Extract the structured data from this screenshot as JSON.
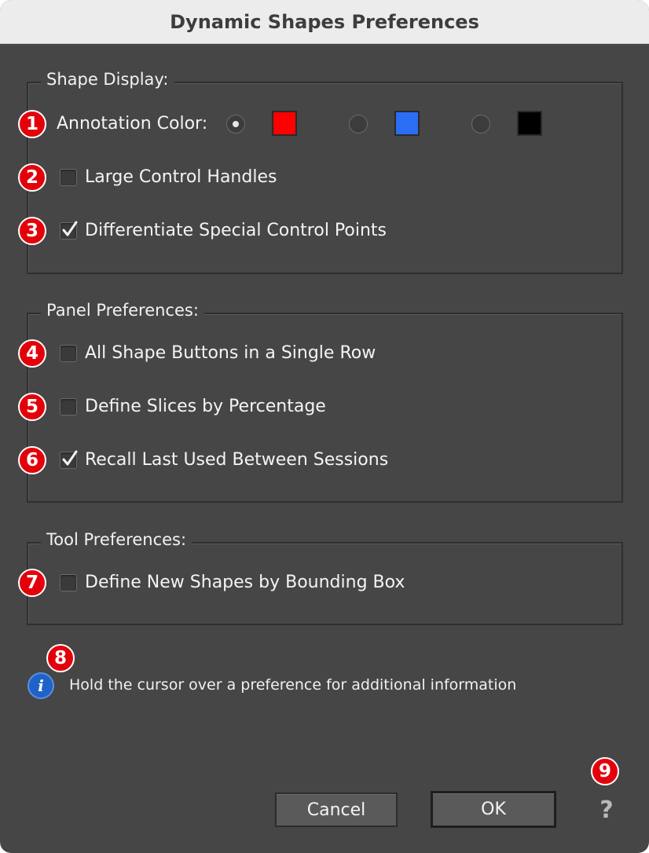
{
  "window": {
    "title": "Dynamic Shapes Preferences"
  },
  "shape_display": {
    "title": "Shape Display:",
    "annotation_color": {
      "label": "Annotation Color:",
      "options": [
        {
          "color": "#ff0000",
          "selected": true
        },
        {
          "color": "#2a6ef5",
          "selected": false
        },
        {
          "color": "#000000",
          "selected": false
        }
      ]
    },
    "large_control_handles": {
      "label": "Large Control Handles",
      "checked": false
    },
    "differentiate_special_points": {
      "label": "Differentiate Special Control Points",
      "checked": true
    }
  },
  "panel_preferences": {
    "title": "Panel Preferences:",
    "single_row": {
      "label": "All Shape Buttons in a Single Row",
      "checked": false
    },
    "slices_by_percentage": {
      "label": "Define Slices by Percentage",
      "checked": false
    },
    "recall_last_used": {
      "label": "Recall Last Used Between Sessions",
      "checked": true
    }
  },
  "tool_preferences": {
    "title": "Tool Preferences:",
    "bounding_box": {
      "label": "Define New Shapes by Bounding Box",
      "checked": false
    }
  },
  "badges": [
    "1",
    "2",
    "3",
    "4",
    "5",
    "6",
    "7",
    "8",
    "9"
  ],
  "info": {
    "text": "Hold the cursor over a preference for additional information",
    "icon": "info-icon"
  },
  "buttons": {
    "cancel": "Cancel",
    "ok": "OK"
  },
  "help": {
    "symbol": "?",
    "icon": "question-mark-icon"
  },
  "colors": {
    "badge": "#e3000b",
    "background": "#464646",
    "titlebar": "#ececec"
  }
}
